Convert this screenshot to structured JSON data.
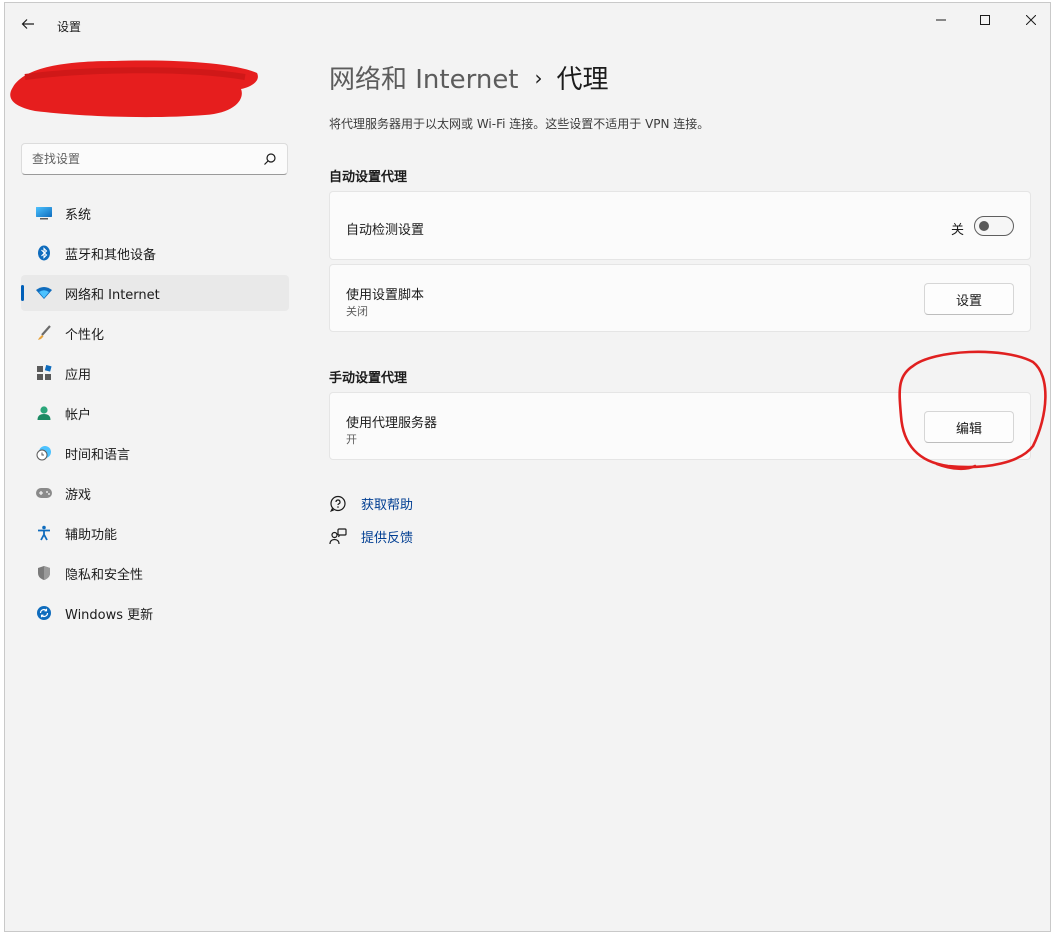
{
  "window": {
    "app_title": "设置"
  },
  "search": {
    "placeholder": "查找设置"
  },
  "sidebar": {
    "items": [
      {
        "label": "系统",
        "icon": "system-icon"
      },
      {
        "label": "蓝牙和其他设备",
        "icon": "bluetooth-icon"
      },
      {
        "label": "网络和 Internet",
        "icon": "wifi-icon",
        "selected": true
      },
      {
        "label": "个性化",
        "icon": "brush-icon"
      },
      {
        "label": "应用",
        "icon": "apps-icon"
      },
      {
        "label": "帐户",
        "icon": "account-icon"
      },
      {
        "label": "时间和语言",
        "icon": "time-language-icon"
      },
      {
        "label": "游戏",
        "icon": "gamepad-icon"
      },
      {
        "label": "辅助功能",
        "icon": "accessibility-icon"
      },
      {
        "label": "隐私和安全性",
        "icon": "shield-icon"
      },
      {
        "label": "Windows 更新",
        "icon": "update-icon"
      }
    ]
  },
  "header": {
    "breadcrumb_parent": "网络和 Internet",
    "breadcrumb_separator": "›",
    "breadcrumb_current": "代理",
    "description": "将代理服务器用于以太网或 Wi-Fi 连接。这些设置不适用于 VPN 连接。"
  },
  "auto_proxy": {
    "section_title": "自动设置代理",
    "auto_detect": {
      "title": "自动检测设置",
      "toggle_state_label": "关",
      "toggle_on": false
    },
    "setup_script": {
      "title": "使用设置脚本",
      "status": "关闭",
      "button_label": "设置"
    }
  },
  "manual_proxy": {
    "section_title": "手动设置代理",
    "use_proxy": {
      "title": "使用代理服务器",
      "status": "开",
      "button_label": "编辑"
    }
  },
  "links": {
    "help": "获取帮助",
    "feedback": "提供反馈"
  },
  "colors": {
    "accent": "#005fb8",
    "link": "#003e92",
    "annotation": "#e02020",
    "redaction": "#e61e1e"
  }
}
